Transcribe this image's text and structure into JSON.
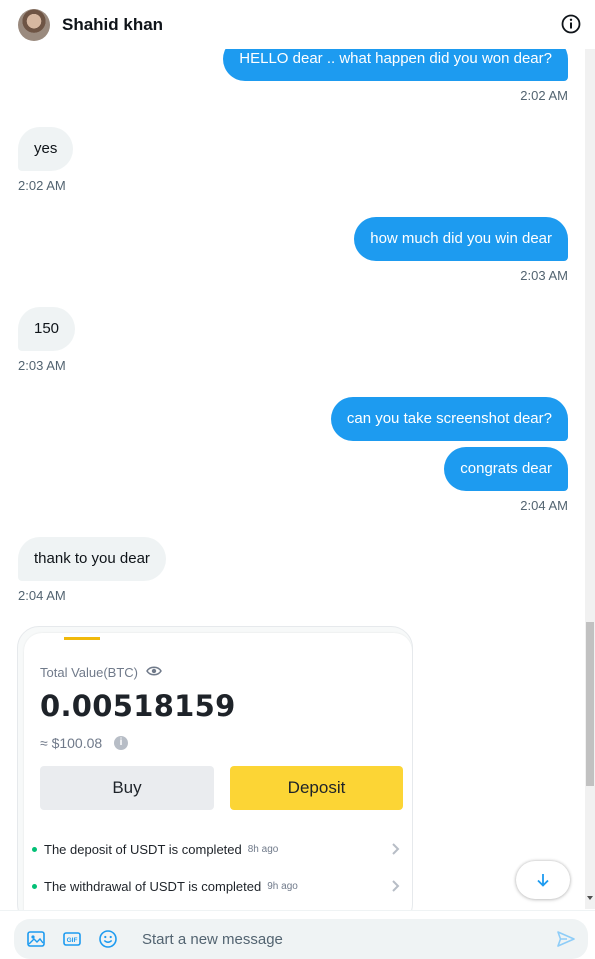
{
  "header": {
    "contact_name": "Shahid khan",
    "avatar_icon": "profile-photo",
    "info_icon": "info-icon"
  },
  "messages": [
    {
      "direction": "out",
      "text": "HELLO dear .. what happen did you won dear?",
      "time": "2:02 AM"
    },
    {
      "direction": "in",
      "text": "yes",
      "time": "2:02 AM"
    },
    {
      "direction": "out",
      "text": "how much did you win dear",
      "time": "2:03 AM"
    },
    {
      "direction": "in",
      "text": "150",
      "time": "2:03 AM"
    },
    {
      "direction": "out",
      "text": "can you take screenshot dear?",
      "time": ""
    },
    {
      "direction": "out",
      "text": "congrats dear",
      "time": "2:04 AM"
    },
    {
      "direction": "in",
      "text": "thank to you dear",
      "time": "2:04 AM"
    }
  ],
  "wallet_card": {
    "total_label": "Total Value(BTC)",
    "btc_value": "0.00518159",
    "usd_value": "≈ $100.08",
    "info_glyph": "i",
    "buy_label": "Buy",
    "deposit_label": "Deposit",
    "notices": [
      {
        "text": "The deposit of USDT is completed",
        "ago": "8h ago"
      },
      {
        "text": "The withdrawal of USDT is completed",
        "ago": "9h ago"
      }
    ],
    "accent_color": "#f0b90b",
    "deposit_color": "#fcd535",
    "status_dot_color": "#02c076"
  },
  "composer": {
    "placeholder": "Start a new message",
    "icons": [
      "image-icon",
      "gif-icon",
      "emoji-icon",
      "send-icon"
    ],
    "gif_label": "GIF"
  },
  "colors": {
    "outgoing_bubble": "#1d9bf0",
    "incoming_bubble": "#eff3f4",
    "timestamp": "#536471"
  }
}
